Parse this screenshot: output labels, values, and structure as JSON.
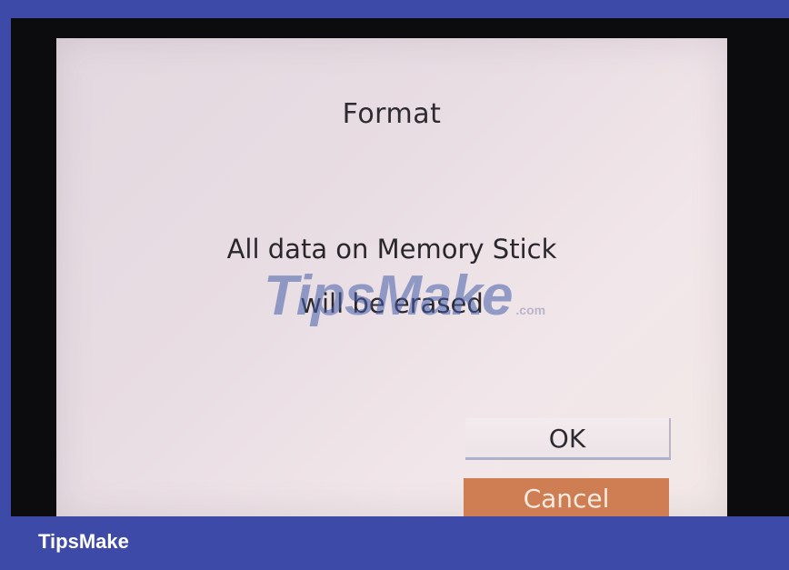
{
  "dialog": {
    "title": "Format",
    "message_line_1": "All data on Memory Stick",
    "message_line_2": "will be erased",
    "ok_label": "OK",
    "cancel_label": "Cancel"
  },
  "watermark": {
    "text": "TipsMake",
    "suffix": ".com"
  },
  "footer": {
    "brand": "TipsMake"
  },
  "colors": {
    "frame": "#3d4aa8",
    "screen_bezel": "#0c0c0e",
    "dialog_background": "#ece2e6",
    "cancel_button": "#cf7d53",
    "text": "#2d2a30"
  }
}
